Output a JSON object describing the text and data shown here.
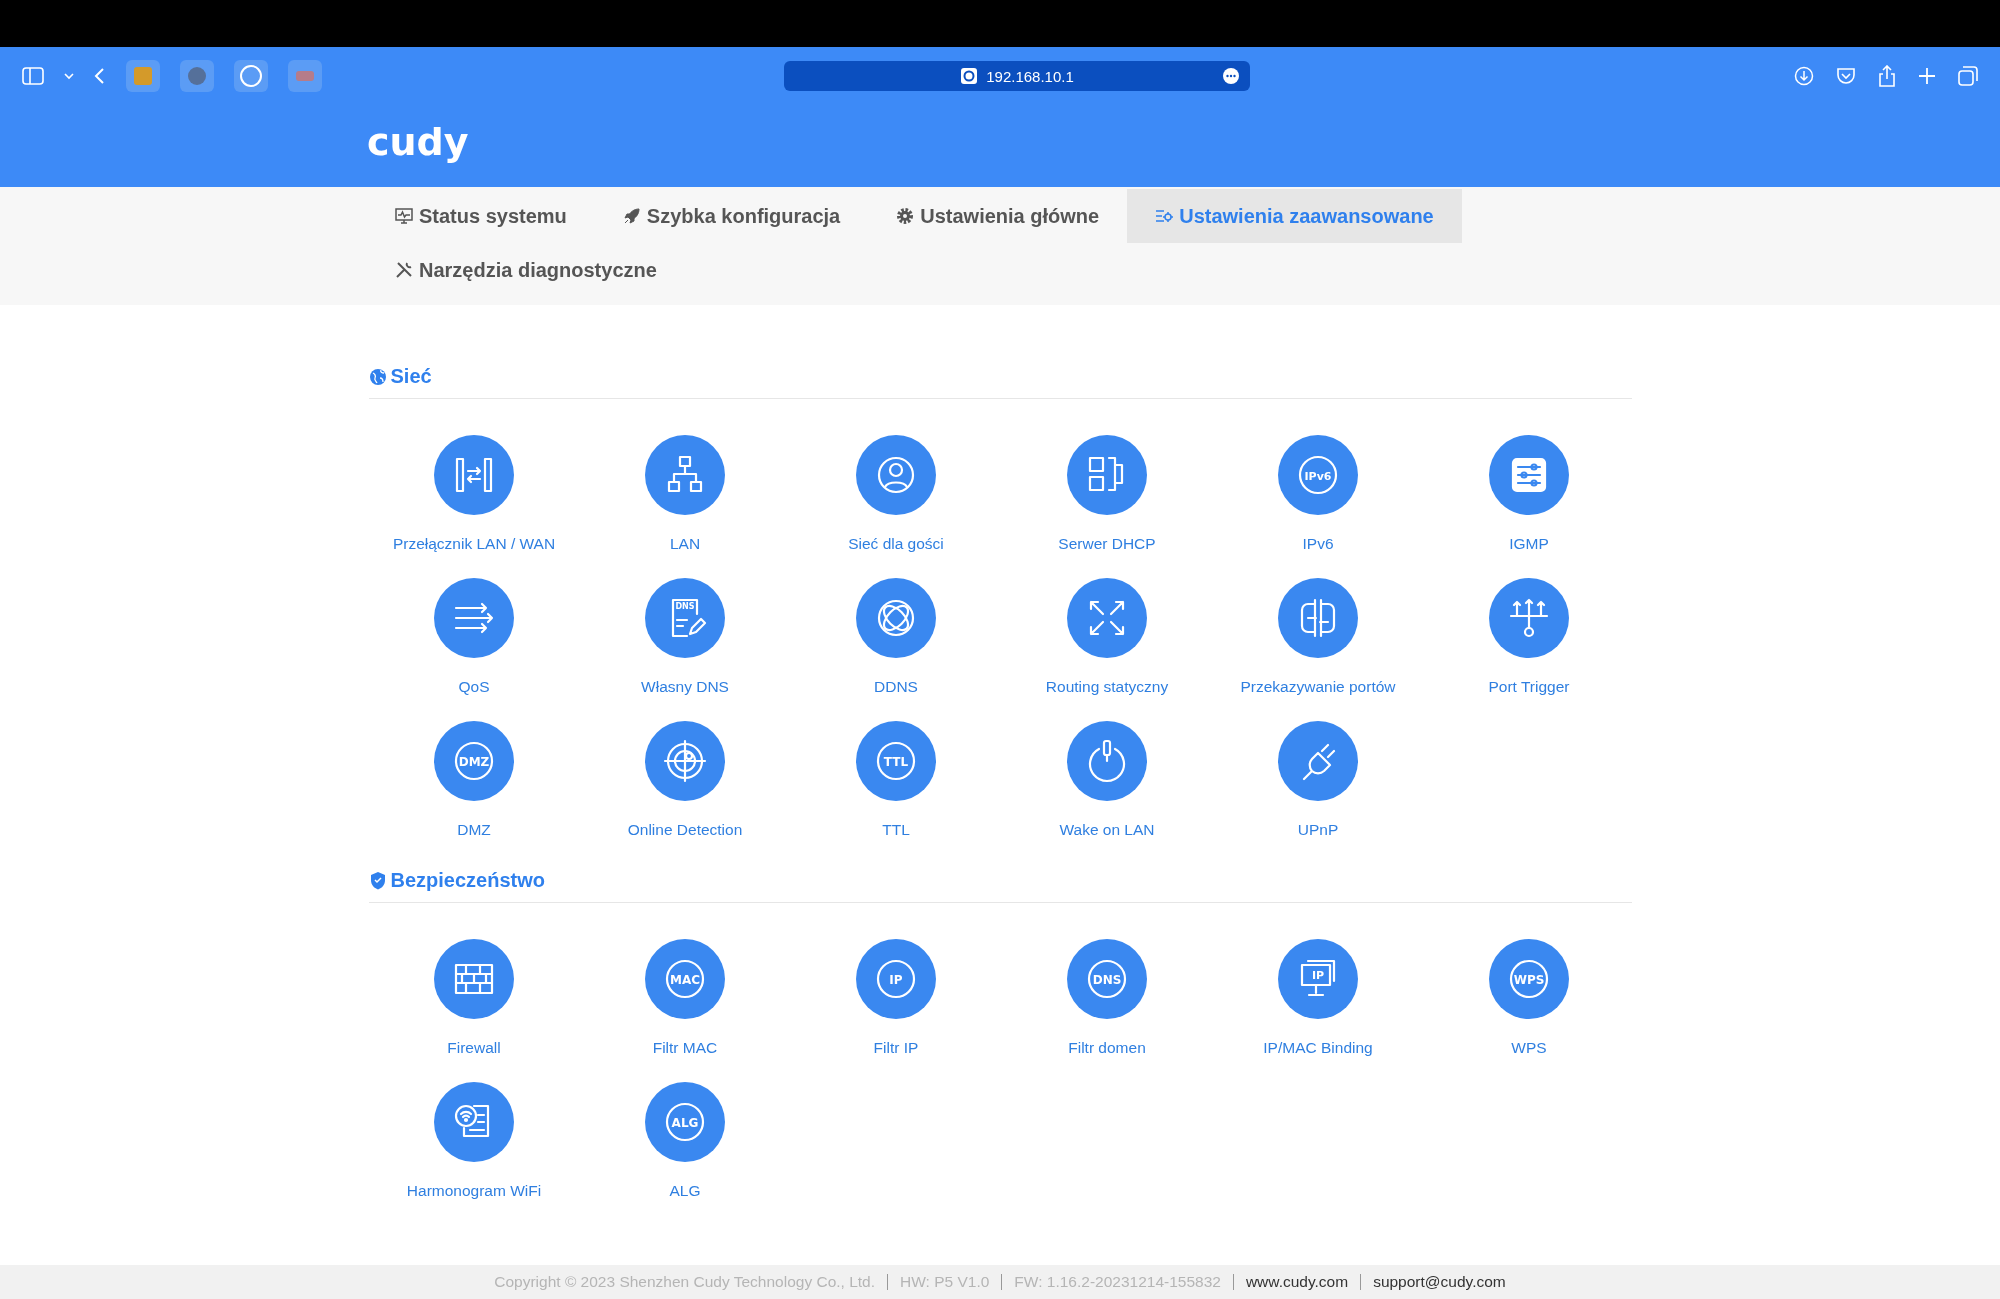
{
  "browser": {
    "url": "192.168.10.1"
  },
  "logo": "cudy",
  "nav": [
    {
      "label": "Status systemu",
      "selected": false
    },
    {
      "label": "Szybka konfiguracja",
      "selected": false
    },
    {
      "label": "Ustawienia główne",
      "selected": false
    },
    {
      "label": "Ustawienia zaawansowane",
      "selected": true
    },
    {
      "label": "Narzędzia diagnostyczne",
      "selected": false
    }
  ],
  "sections": [
    {
      "title": "Sieć",
      "items": [
        {
          "label": "Przełącznik LAN / WAN",
          "kind": "lanwan"
        },
        {
          "label": "LAN",
          "kind": "lan"
        },
        {
          "label": "Sieć dla gości",
          "kind": "guest"
        },
        {
          "label": "Serwer DHCP",
          "kind": "dhcp"
        },
        {
          "label": "IPv6",
          "kind": "ring",
          "icon_text": "IPv6"
        },
        {
          "label": "IGMP",
          "kind": "igmp"
        },
        {
          "label": "QoS",
          "kind": "qos"
        },
        {
          "label": "Własny DNS",
          "kind": "dns",
          "icon_text": "DNS"
        },
        {
          "label": "DDNS",
          "kind": "ddns"
        },
        {
          "label": "Routing statyczny",
          "kind": "routing"
        },
        {
          "label": "Przekazywanie portów",
          "kind": "portfwd"
        },
        {
          "label": "Port Trigger",
          "kind": "trigger"
        },
        {
          "label": "DMZ",
          "kind": "ring",
          "icon_text": "DMZ"
        },
        {
          "label": "Online Detection",
          "kind": "online"
        },
        {
          "label": "TTL",
          "kind": "ring",
          "icon_text": "TTL"
        },
        {
          "label": "Wake on LAN",
          "kind": "wol"
        },
        {
          "label": "UPnP",
          "kind": "upnp"
        }
      ]
    },
    {
      "title": "Bezpieczeństwo",
      "items": [
        {
          "label": "Firewall",
          "kind": "firewall"
        },
        {
          "label": "Filtr MAC",
          "kind": "ring",
          "icon_text": "MAC"
        },
        {
          "label": "Filtr IP",
          "kind": "ring",
          "icon_text": "IP"
        },
        {
          "label": "Filtr domen",
          "kind": "ring",
          "icon_text": "DNS"
        },
        {
          "label": "IP/MAC Binding",
          "kind": "ipmac",
          "icon_text": "IP"
        },
        {
          "label": "WPS",
          "kind": "ring",
          "icon_text": "WPS"
        },
        {
          "label": "Harmonogram WiFi",
          "kind": "schedule"
        },
        {
          "label": "ALG",
          "kind": "ring",
          "icon_text": "ALG"
        }
      ]
    }
  ],
  "footer": {
    "copyright": "Copyright © 2023 Shenzhen Cudy Technology Co., Ltd.",
    "hw": "HW: P5 V1.0",
    "fw": "FW: 1.16.2-20231214-155832",
    "website": "www.cudy.com",
    "support": "support@cudy.com"
  }
}
